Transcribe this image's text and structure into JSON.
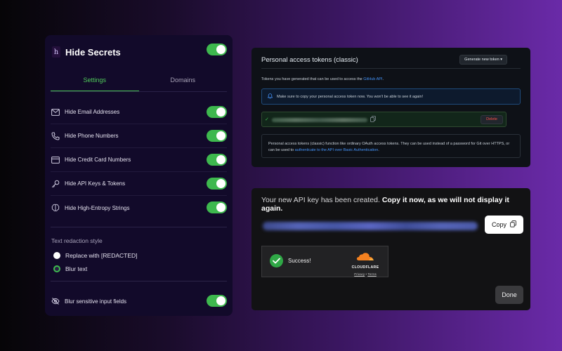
{
  "extension": {
    "title": "Hide Secrets",
    "logo_text": "h",
    "master_enabled": true,
    "tabs": [
      {
        "label": "Settings",
        "active": true
      },
      {
        "label": "Domains",
        "active": false
      }
    ],
    "options": [
      {
        "label": "Hide Email Addresses",
        "icon": "mail-icon",
        "enabled": true
      },
      {
        "label": "Hide Phone Numbers",
        "icon": "phone-icon",
        "enabled": true
      },
      {
        "label": "Hide Credit Card Numbers",
        "icon": "credit-card-icon",
        "enabled": true
      },
      {
        "label": "Hide API Keys & Tokens",
        "icon": "key-icon",
        "enabled": true
      },
      {
        "label": "Hide High-Entropy Strings",
        "icon": "brain-icon",
        "enabled": true
      }
    ],
    "redaction": {
      "section_label": "Text redaction style",
      "options": [
        {
          "label": "Replace with [REDACTED]",
          "selected": false
        },
        {
          "label": "Blur text",
          "selected": true
        }
      ]
    },
    "blur_inputs": {
      "label": "Blur sensitive input fields",
      "icon": "eye-off-icon",
      "enabled": true
    },
    "accent_color": "#3eb84e"
  },
  "github": {
    "title": "Personal access tokens (classic)",
    "generate_button": "Generate new token ▾",
    "intro_text": "Tokens you have generated that can be used to access the ",
    "intro_link": "GitHub API",
    "intro_end": ".",
    "flash_text": "Make sure to copy your personal access token now. You won't be able to see it again!",
    "delete_button": "Delete",
    "note_text": "Personal access tokens (classic) function like ordinary OAuth access tokens. They can be used instead of a password for Git over HTTPS, or can be used to ",
    "note_link": "authenticate to the API over Basic Authentication",
    "note_end": "."
  },
  "api_dialog": {
    "message_normal": "Your new API key has been created. ",
    "message_bold": "Copy it now, as we will not display it again.",
    "copy_button": "Copy",
    "captcha": {
      "status": "Success!",
      "brand": "CLOUDFLARE",
      "privacy_link": "Privacy",
      "separator": " • ",
      "terms_link": "Terms"
    },
    "done_button": "Done"
  }
}
